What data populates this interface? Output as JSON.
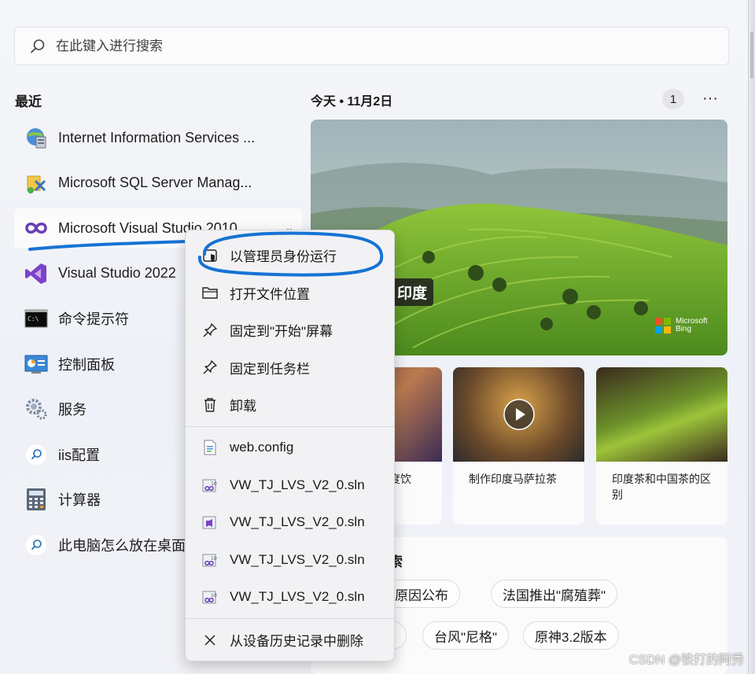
{
  "search": {
    "placeholder": "在此键入进行搜索"
  },
  "recent": {
    "title": "最近",
    "items": [
      {
        "label": "Internet Information Services ...",
        "icon": "iis-manager-icon"
      },
      {
        "label": "Microsoft SQL Server Manag...",
        "icon": "sql-server-icon"
      },
      {
        "label": "Microsoft Visual Studio 2010",
        "icon": "visual-studio-2010-icon"
      },
      {
        "label": "Visual Studio 2022",
        "icon": "visual-studio-2022-icon"
      },
      {
        "label": "命令提示符",
        "icon": "command-prompt-icon"
      },
      {
        "label": "控制面板",
        "icon": "control-panel-icon"
      },
      {
        "label": "服务",
        "icon": "services-gear-icon"
      },
      {
        "label": "iis配置",
        "icon": "search-result-icon"
      },
      {
        "label": "计算器",
        "icon": "calculator-icon"
      },
      {
        "label": "此电脑怎么放在桌面",
        "icon": "search-result-icon"
      }
    ]
  },
  "today": {
    "title": "今天 • 11月2日",
    "count": "1",
    "more": "···",
    "hero_caption": "，印度",
    "bing_brand": "Microsoft Bing",
    "cards": [
      {
        "caption": "度饮"
      },
      {
        "caption": "制作印度马萨拉茶"
      },
      {
        "caption": "印度茶和中国茶的区别"
      }
    ],
    "trending_title": "索",
    "chips": [
      "故原因公布",
      "法国推出\"腐殖葬\"",
      "青",
      "台风\"尼格\"",
      "原神3.2版本"
    ]
  },
  "context_menu": {
    "items": [
      {
        "label": "以管理员身份运行",
        "icon": "shield-icon"
      },
      {
        "label": "打开文件位置",
        "icon": "folder-icon"
      },
      {
        "label": "固定到\"开始\"屏幕",
        "icon": "pin-icon"
      },
      {
        "label": "固定到任务栏",
        "icon": "pin-icon"
      },
      {
        "label": "卸载",
        "icon": "trash-icon"
      }
    ],
    "files": [
      {
        "label": "web.config",
        "icon": "config-file-icon"
      },
      {
        "label": "VW_TJ_LVS_V2_0.sln",
        "icon": "sln-file-icon"
      },
      {
        "label": "VW_TJ_LVS_V2_0.sln",
        "icon": "sln-file-icon"
      },
      {
        "label": "VW_TJ_LVS_V2_0.sln",
        "icon": "sln-file-icon"
      },
      {
        "label": "VW_TJ_LVS_V2_0.sln",
        "icon": "sln-file-icon"
      }
    ],
    "remove": {
      "label": "从设备历史记录中删除",
      "icon": "close-icon"
    }
  },
  "watermark": "CSDN @铁打的阿秀",
  "colors": {
    "annotation_blue": "#1673d4",
    "vs_purple": "#7b43c7"
  }
}
